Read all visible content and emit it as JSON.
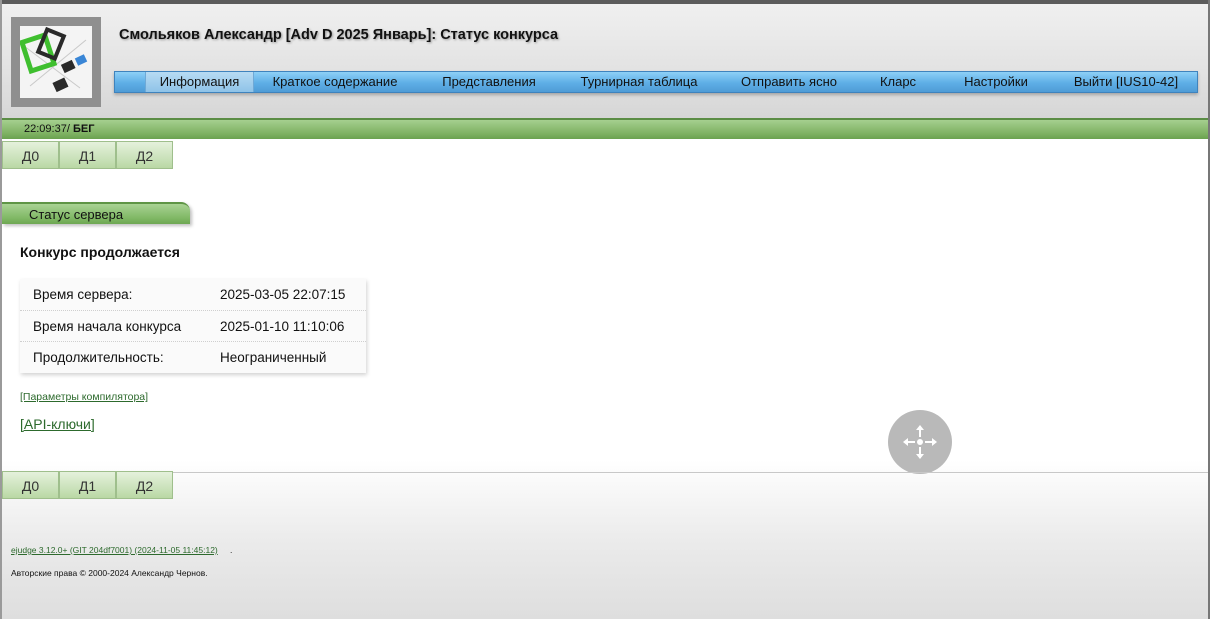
{
  "header": {
    "title": "Смольяков Александр [Adv D 2025 Январь]: Статус конкурса",
    "logo_icon": "ejudge-logo-icon"
  },
  "menu": {
    "items": [
      {
        "label": "Информация",
        "active": true
      },
      {
        "label": "Краткое содержание",
        "active": false
      },
      {
        "label": "Представления",
        "active": false
      },
      {
        "label": "Турнирная таблица",
        "active": false
      },
      {
        "label": "Отправить ясно",
        "active": false
      },
      {
        "label": "Кларс",
        "active": false
      },
      {
        "label": "Настройки",
        "active": false
      },
      {
        "label": "Выйти [IUS10-42]",
        "active": false
      }
    ]
  },
  "status_bar": {
    "time": "22:09:37",
    "state": "БЕГ"
  },
  "problem_tabs": {
    "top": [
      "Д0",
      "Д1",
      "Д2"
    ],
    "bottom": [
      "Д0",
      "Д1",
      "Д2"
    ]
  },
  "section": {
    "title": "Статус сервера",
    "contest_status": "Конкурс продолжается"
  },
  "info_table": {
    "rows": [
      {
        "label": "Время сервера:",
        "value": "2025-03-05 22:07:15"
      },
      {
        "label": "Время начала конкурса",
        "value": "2025-01-10 11:10:06"
      },
      {
        "label": "Продолжительность:",
        "value": "Неограниченный"
      }
    ]
  },
  "links": {
    "compiler_params": "[Параметры компилятора]",
    "api_keys": "[API-ключи]"
  },
  "overlay": {
    "move_icon": "move-arrows-icon"
  },
  "footer": {
    "version": "ejudge 3.12.0+ (GIT 204df7001) (2024-11-05 11:45:12)",
    "version_suffix": ".",
    "copyright": "Авторские права © 2000-2024 Александр Чернов."
  },
  "colors": {
    "menu_blue": "#5eaee6",
    "status_green": "#7fb263",
    "tab_green": "#c7e0b6",
    "link_green": "#2d6a2d"
  }
}
